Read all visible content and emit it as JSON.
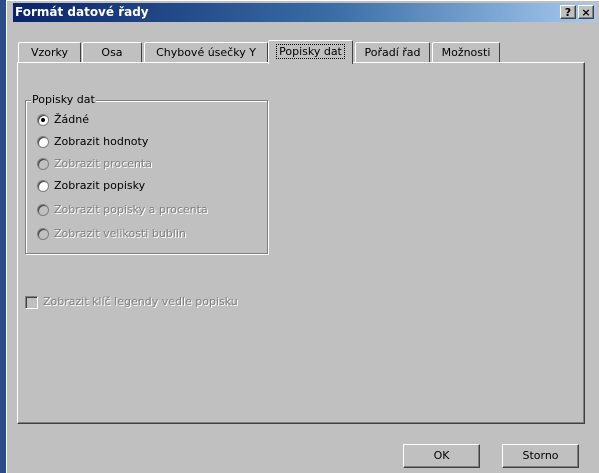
{
  "window": {
    "title": "Formát datové řady",
    "help_label": "?",
    "close_label": "×"
  },
  "tabs": [
    {
      "label": "Vzorky",
      "active": false
    },
    {
      "label": "Osa",
      "active": false
    },
    {
      "label": "Chybové úsečky Y",
      "active": false
    },
    {
      "label": "Popisky dat",
      "active": true
    },
    {
      "label": "Pořadí řad",
      "active": false
    },
    {
      "label": "Možnosti",
      "active": false
    }
  ],
  "data_labels_group": {
    "legend": "Popisky dat",
    "options": [
      {
        "label": "Žádné",
        "selected": true,
        "enabled": true
      },
      {
        "label": "Zobrazit hodnoty",
        "selected": false,
        "enabled": true
      },
      {
        "label": "Zobrazit procenta",
        "selected": false,
        "enabled": false
      },
      {
        "label": "Zobrazit popisky",
        "selected": false,
        "enabled": true
      },
      {
        "label": "Zobrazit popisky a procenta",
        "selected": false,
        "enabled": false
      },
      {
        "label": "Zobrazit velikosti bublin",
        "selected": false,
        "enabled": false
      }
    ]
  },
  "legend_key_checkbox": {
    "label": "Zobrazit klíč legendy vedle popisku",
    "checked": false,
    "enabled": false
  },
  "buttons": {
    "ok": "OK",
    "cancel": "Storno"
  }
}
